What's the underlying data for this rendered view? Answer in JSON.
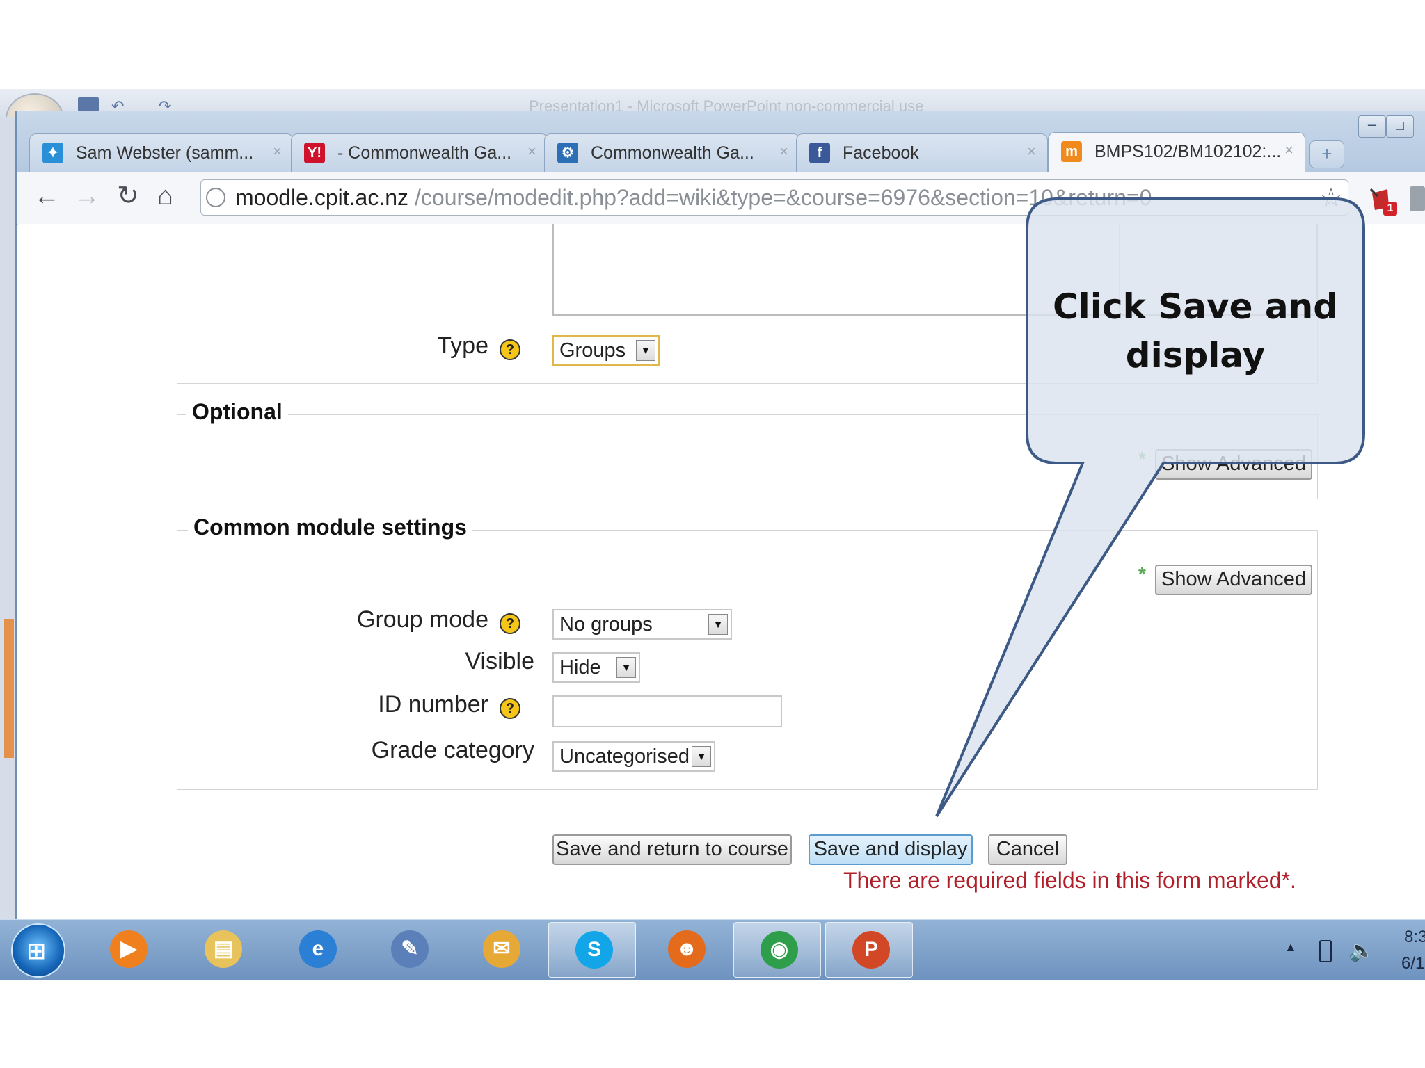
{
  "powerpoint": {
    "title": "Presentation1 - Microsoft PowerPoint non-commercial use"
  },
  "browser": {
    "tabs": [
      {
        "label": "Sam Webster (samm...",
        "icon": "twitter-bird-icon",
        "color": "#2a8fd6",
        "glyph": "✦"
      },
      {
        "label": "- Commonwealth Ga...",
        "icon": "yahoo-icon",
        "color": "#d0112b",
        "glyph": "Y!"
      },
      {
        "label": "Commonwealth Ga...",
        "icon": "cycling-icon",
        "color": "#2d6fb6",
        "glyph": "⚙"
      },
      {
        "label": "Facebook",
        "icon": "facebook-icon",
        "color": "#3b5998",
        "glyph": "f"
      },
      {
        "label": "BMPS102/BM102102:...",
        "icon": "moodle-icon",
        "color": "#f08a1c",
        "glyph": "m"
      }
    ],
    "address": {
      "host": "moodle.cpit.ac.nz",
      "path": "/course/modedit.php?add=wiki&type=&course=6976&section=10&return=0"
    },
    "extension_badge": "1"
  },
  "form": {
    "type": {
      "label": "Type",
      "value": "Groups",
      "help": "?"
    },
    "optional": {
      "legend": "Optional",
      "show_advanced": "Show Advanced",
      "required_marker": "*"
    },
    "common": {
      "legend": "Common module settings",
      "show_advanced": "Show Advanced",
      "required_marker": "*",
      "group_mode": {
        "label": "Group mode",
        "value": "No groups",
        "help": "?"
      },
      "visible": {
        "label": "Visible",
        "value": "Hide"
      },
      "id_number": {
        "label": "ID number",
        "value": "",
        "help": "?"
      },
      "grade_category": {
        "label": "Grade category",
        "value": "Uncategorised"
      }
    },
    "buttons": {
      "save_return": "Save and return to course",
      "save_display": "Save and display",
      "cancel": "Cancel"
    },
    "required_note": "There are required fields in this form marked*."
  },
  "callout": {
    "line1": "Click Save and",
    "line2": "display",
    "fill": "#dce3ef",
    "stroke": "#3d5a86"
  },
  "taskbar": {
    "apps": [
      {
        "name": "media-player-icon",
        "color": "#f07f1d",
        "glyph": "▶",
        "active": false
      },
      {
        "name": "file-explorer-icon",
        "color": "#e8c25a",
        "glyph": "▤",
        "active": false
      },
      {
        "name": "internet-explorer-icon",
        "color": "#2b7fd4",
        "glyph": "e",
        "active": false
      },
      {
        "name": "user-accounts-icon",
        "color": "#5b7fb8",
        "glyph": "✎",
        "active": false
      },
      {
        "name": "outlook-icon",
        "color": "#e7a935",
        "glyph": "✉",
        "active": false
      },
      {
        "name": "skype-icon",
        "color": "#12a5e8",
        "glyph": "S",
        "active": true
      },
      {
        "name": "firefox-icon",
        "color": "#e46a1c",
        "glyph": "☻",
        "active": false
      },
      {
        "name": "chrome-icon",
        "color": "#2e9e4a",
        "glyph": "◉",
        "active": true
      },
      {
        "name": "powerpoint-icon",
        "color": "#d24726",
        "glyph": "P",
        "active": true
      }
    ],
    "time": "8:3",
    "date": "6/1"
  }
}
